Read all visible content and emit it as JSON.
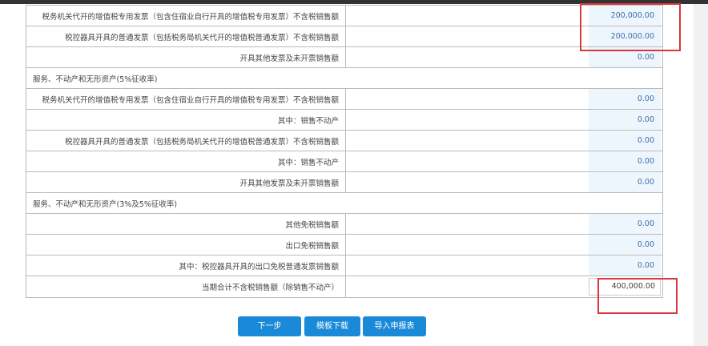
{
  "rows": [
    {
      "type": "item",
      "label": "税务机关代开的增值税专用发票（包含住宿业自行开具的增值税专用发票）不含税销售额",
      "value": "200,000.00"
    },
    {
      "type": "item",
      "label": "税控器具开具的普通发票（包括税务局机关代开的增值税普通发票）不含税销售额",
      "value": "200,000.00"
    },
    {
      "type": "item",
      "label": "开具其他发票及未开票销售额",
      "value": "0.00"
    },
    {
      "type": "section",
      "label": "服务、不动产和无形资产(5%征收率)"
    },
    {
      "type": "item",
      "label": "税务机关代开的增值税专用发票（包含住宿业自行开具的增值税专用发票）不含税销售额",
      "value": "0.00"
    },
    {
      "type": "item",
      "label": "其中：销售不动产",
      "value": "0.00"
    },
    {
      "type": "item",
      "label": "税控器具开具的普通发票（包括税务局机关代开的增值税普通发票）不含税销售额",
      "value": "0.00"
    },
    {
      "type": "item",
      "label": "其中：销售不动产",
      "value": "0.00"
    },
    {
      "type": "item",
      "label": "开具其他发票及未开票销售额",
      "value": "0.00"
    },
    {
      "type": "section",
      "label": "服务、不动产和无形资产(3%及5%征收率)"
    },
    {
      "type": "item",
      "label": "其他免税销售额",
      "value": "0.00"
    },
    {
      "type": "item",
      "label": "出口免税销售额",
      "value": "0.00"
    },
    {
      "type": "item",
      "label": "其中：税控器具开具的出口免税普通发票销售额",
      "value": "0.00"
    },
    {
      "type": "total",
      "label": "当期合计不含税销售额（除销售不动产）",
      "value": "400,000.00"
    }
  ],
  "buttons": {
    "next": "下一步",
    "template": "模板下载",
    "import": "导入申报表"
  },
  "colors": {
    "accent": "#1a8ad8",
    "highlight": "#d9363e"
  }
}
